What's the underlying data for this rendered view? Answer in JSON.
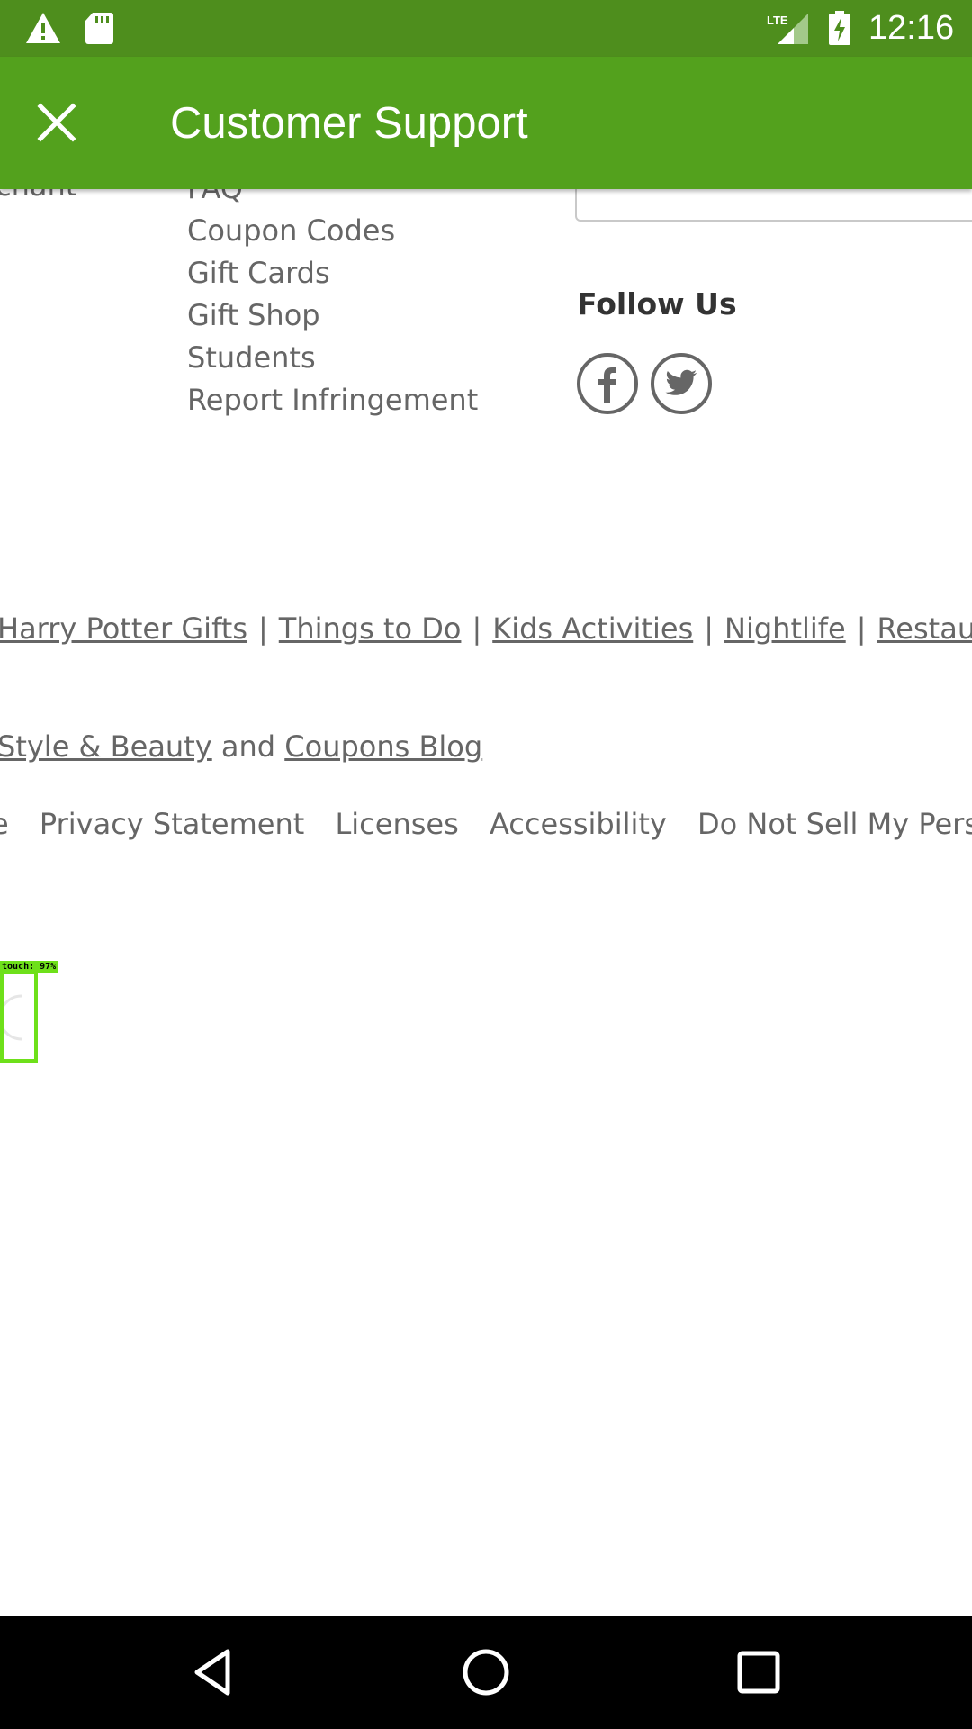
{
  "status_bar": {
    "time": "12:16",
    "icons": [
      "warning-icon",
      "sd-card-icon",
      "lte-signal-icon",
      "battery-charging-icon"
    ],
    "background": "#4e8e1d"
  },
  "app_bar": {
    "title": "Customer Support",
    "close_icon": "close-icon",
    "background": "#53a11d"
  },
  "content": {
    "cut_left_text": "chant",
    "links": [
      "FAQ",
      "Coupon Codes",
      "Gift Cards",
      "Gift Shop",
      "Students",
      "Report Infringement"
    ],
    "follow_us": {
      "title": "Follow Us",
      "icons": [
        "facebook-icon",
        "twitter-icon"
      ]
    },
    "footer_links": [
      "Harry Potter Gifts",
      "Things to Do",
      "Kids Activities",
      "Nightlife",
      "Restaurants"
    ],
    "blog_line": {
      "link1": "Style & Beauty",
      "connector": " and ",
      "link2": "Coupons Blog"
    },
    "legal_links": [
      "e",
      "Privacy Statement",
      "Licenses",
      "Accessibility",
      "Do Not Sell My Personal Inf"
    ],
    "touch_overlay_label": "touch: 97%"
  },
  "nav_bar": {
    "icons": [
      "back-icon",
      "home-icon",
      "recent-apps-icon"
    ]
  }
}
